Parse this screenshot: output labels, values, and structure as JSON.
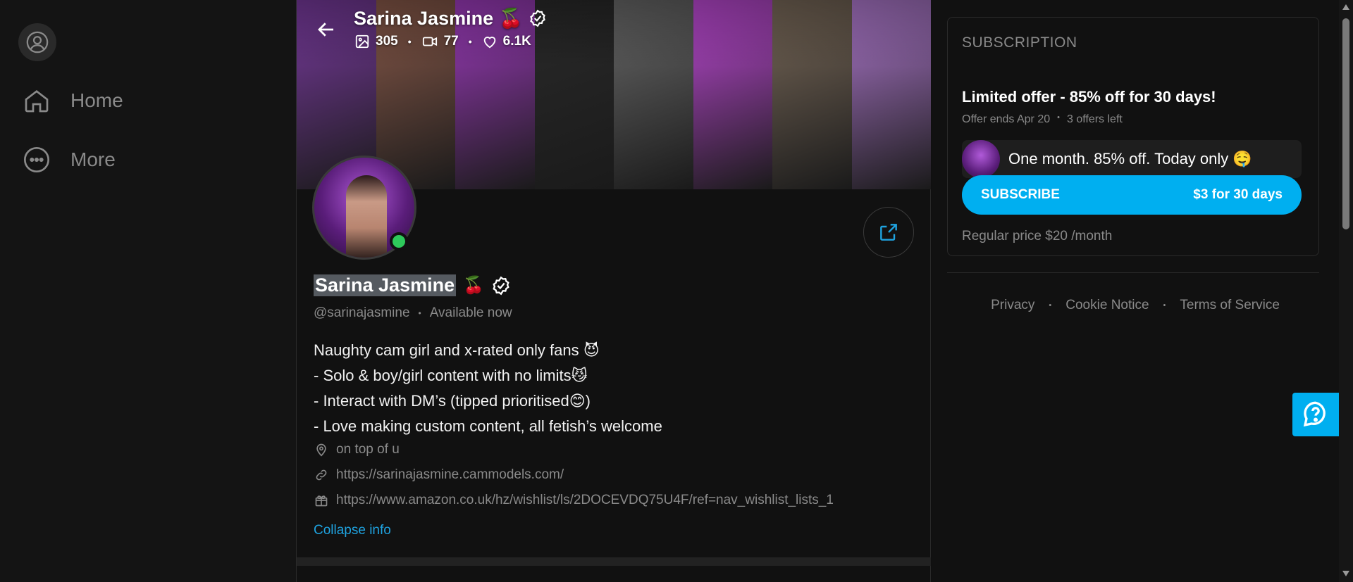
{
  "nav": {
    "items": [
      {
        "label": "Home",
        "icon": "home-icon"
      },
      {
        "label": "More",
        "icon": "more-icon"
      }
    ]
  },
  "banner": {
    "title": "Sarina Jasmine",
    "title_emoji": "🍒",
    "stats": {
      "posts": "305",
      "videos": "77",
      "likes": "6.1K"
    },
    "strip_colors": [
      "#7a3ba0",
      "#8a5a4a",
      "#a03cc0",
      "#2a2a2a",
      "#6a6a6a",
      "#c04ad8",
      "#7a6a5a",
      "#b07ad0"
    ]
  },
  "profile": {
    "name": "Sarina Jasmine",
    "name_emoji": "🍒",
    "handle": "@sarinajasmine",
    "status": "Available now",
    "bio": [
      "Naughty cam girl and x-rated only fans 😈",
      "- Solo & boy/girl content with no limits😼",
      "- Interact with DM’s (tipped prioritised😊)",
      "- Love making custom content, all fetish’s welcome"
    ],
    "location": "on top of u",
    "link": "https://sarinajasmine.cammodels.com/",
    "wishlist": "https://www.amazon.co.uk/hz/wishlist/ls/2DOCEVDQ75U4F/ref=nav_wishlist_lists_1",
    "collapse_label": "Collapse info"
  },
  "subscription": {
    "heading": "SUBSCRIPTION",
    "offer_title": "Limited offer - 85% off for 30 days!",
    "offer_ends": "Offer ends Apr 20",
    "offers_left": "3 offers left",
    "promo_text": "One month. 85% off. Today only 🤤",
    "button_label": "SUBSCRIBE",
    "button_price": "$3 for 30 days",
    "regular_price": "Regular price $20 /month"
  },
  "footer": {
    "links": [
      "Privacy",
      "Cookie Notice",
      "Terms of Service"
    ]
  },
  "colors": {
    "accent": "#00aff0",
    "online": "#2ec95b",
    "link": "#1fa3e0"
  }
}
